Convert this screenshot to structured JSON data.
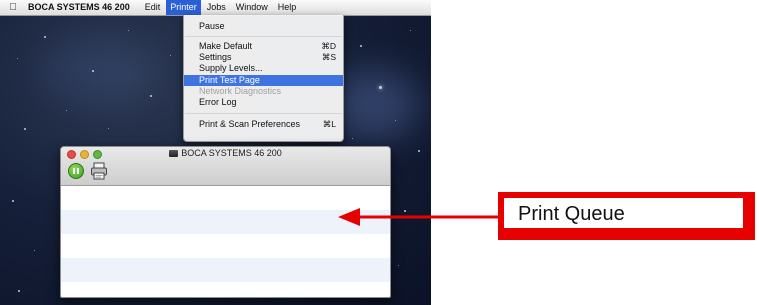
{
  "menubar": {
    "apple_icon": "apple-icon",
    "app_name": "BOCA SYSTEMS 46 200",
    "items": [
      "Edit",
      "Printer",
      "Jobs",
      "Window",
      "Help"
    ],
    "active_item": "Printer"
  },
  "printer_menu": {
    "pause": "Pause",
    "make_default": "Make Default",
    "make_default_shortcut": "⌘D",
    "settings": "Settings",
    "settings_shortcut": "⌘S",
    "supply_levels": "Supply Levels...",
    "print_test_page": "Print Test Page",
    "network_diagnostics": "Network Diagnostics",
    "error_log": "Error Log",
    "print_scan_prefs": "Print & Scan Preferences",
    "print_scan_prefs_shortcut": "⌘L",
    "highlighted": "Print Test Page",
    "disabled": "Network Diagnostics"
  },
  "window": {
    "title": "BOCA SYSTEMS 46 200",
    "title_icon": "printer-icon",
    "toolbar": {
      "pause_icon": "pause-icon",
      "settings_icon": "printer-settings-icon"
    },
    "queue_rows": 4
  },
  "annotation": {
    "label": "Print Queue",
    "color": "#e60000"
  },
  "colors": {
    "menu_highlight": "#3e73e0",
    "accent_red": "#e60000",
    "desktop": "#16203a"
  }
}
